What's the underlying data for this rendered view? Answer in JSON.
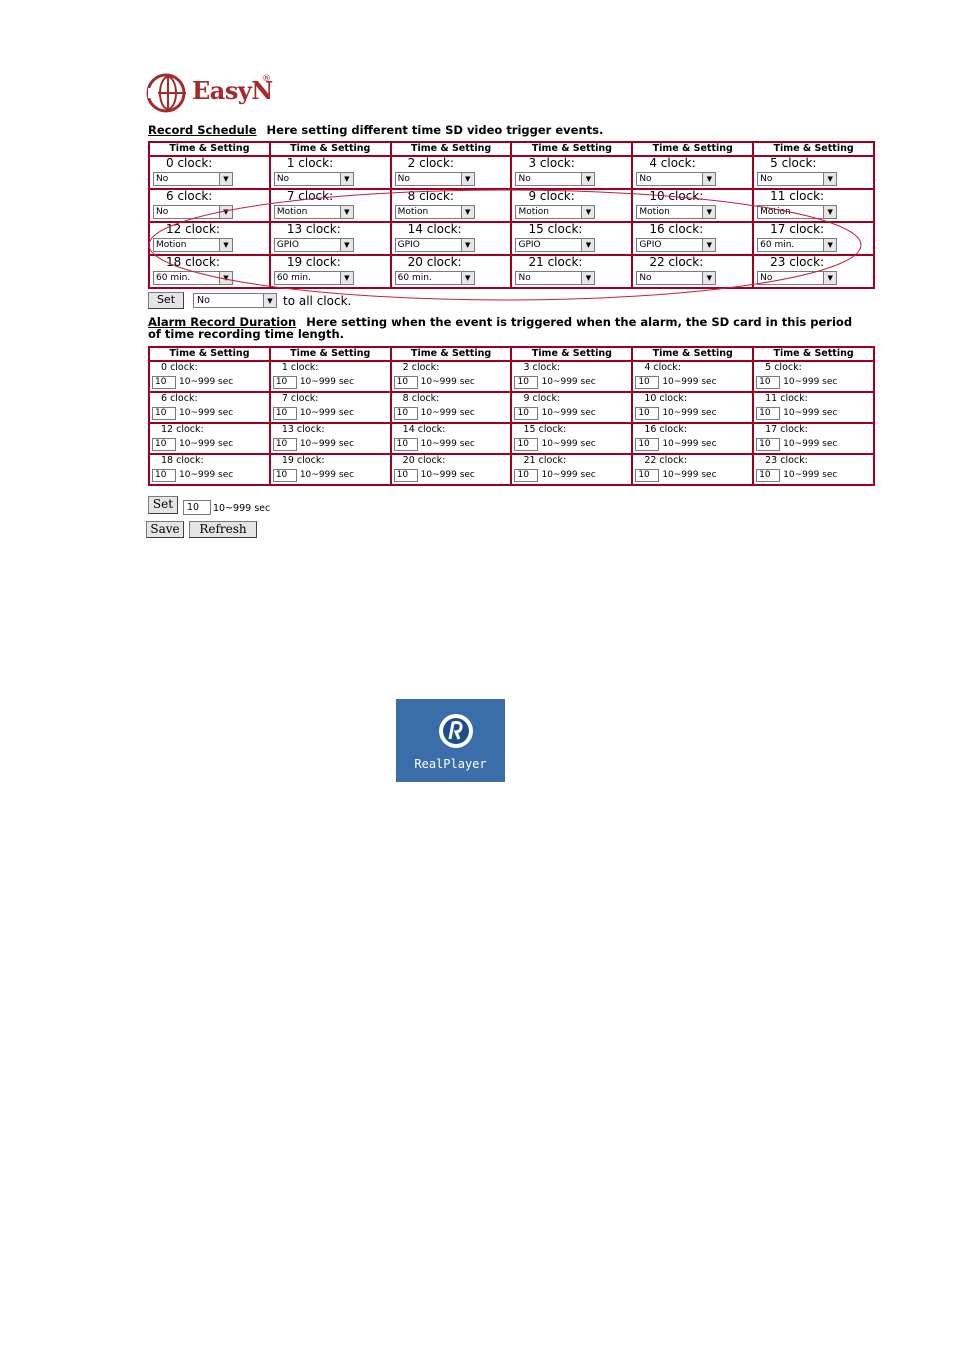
{
  "logo": {
    "text": "EasyN",
    "reg": "®"
  },
  "schedule": {
    "link": "Record Schedule",
    "desc": "Here setting different time SD video trigger events.",
    "header": "Time & Setting",
    "cells": [
      {
        "label": "0 clock:",
        "value": "No"
      },
      {
        "label": "1 clock:",
        "value": "No"
      },
      {
        "label": "2 clock:",
        "value": "No"
      },
      {
        "label": "3 clock:",
        "value": "No"
      },
      {
        "label": "4 clock:",
        "value": "No"
      },
      {
        "label": "5 clock:",
        "value": "No"
      },
      {
        "label": "6 clock:",
        "value": "No"
      },
      {
        "label": "7 clock:",
        "value": "Motion"
      },
      {
        "label": "8 clock:",
        "value": "Motion"
      },
      {
        "label": "9 clock:",
        "value": "Motion"
      },
      {
        "label": "10 clock:",
        "value": "Motion"
      },
      {
        "label": "11 clock:",
        "value": "Motion"
      },
      {
        "label": "12 clock:",
        "value": "Motion"
      },
      {
        "label": "13 clock:",
        "value": "GPIO"
      },
      {
        "label": "14 clock:",
        "value": "GPIO"
      },
      {
        "label": "15 clock:",
        "value": "GPIO"
      },
      {
        "label": "16 clock:",
        "value": "GPIO"
      },
      {
        "label": "17 clock:",
        "value": "60 min."
      },
      {
        "label": "18 clock:",
        "value": "60 min."
      },
      {
        "label": "19 clock:",
        "value": "60 min."
      },
      {
        "label": "20 clock:",
        "value": "60 min."
      },
      {
        "label": "21 clock:",
        "value": "No"
      },
      {
        "label": "22 clock:",
        "value": "No"
      },
      {
        "label": "23 clock:",
        "value": "No"
      }
    ],
    "set_label": "Set",
    "set_value": "No",
    "to_all": "to all clock."
  },
  "duration": {
    "link": "Alarm Record Duration",
    "desc": "Here setting when the event is triggered when the alarm, the SD card in this period of time recording time length.",
    "header": "Time & Setting",
    "range": "10~999 sec",
    "cells": [
      {
        "label": "0 clock:",
        "value": "10"
      },
      {
        "label": "1 clock:",
        "value": "10"
      },
      {
        "label": "2 clock:",
        "value": "10"
      },
      {
        "label": "3 clock:",
        "value": "10"
      },
      {
        "label": "4 clock:",
        "value": "10"
      },
      {
        "label": "5 clock:",
        "value": "10"
      },
      {
        "label": "6 clock:",
        "value": "10"
      },
      {
        "label": "7 clock:",
        "value": "10"
      },
      {
        "label": "8 clock:",
        "value": "10"
      },
      {
        "label": "9 clock:",
        "value": "10"
      },
      {
        "label": "10 clock:",
        "value": "10"
      },
      {
        "label": "11 clock:",
        "value": "10"
      },
      {
        "label": "12 clock:",
        "value": "10"
      },
      {
        "label": "13 clock:",
        "value": "10"
      },
      {
        "label": "14 clock:",
        "value": "10"
      },
      {
        "label": "15 clock:",
        "value": "10"
      },
      {
        "label": "16 clock:",
        "value": "10"
      },
      {
        "label": "17 clock:",
        "value": "10"
      },
      {
        "label": "18 clock:",
        "value": "10"
      },
      {
        "label": "19 clock:",
        "value": "10"
      },
      {
        "label": "20 clock:",
        "value": "10"
      },
      {
        "label": "21 clock:",
        "value": "10"
      },
      {
        "label": "22 clock:",
        "value": "10"
      },
      {
        "label": "23 clock:",
        "value": "10"
      }
    ],
    "set_label": "Set",
    "set_value": "10",
    "set_range": "10~999 sec"
  },
  "actions": {
    "save": "Save",
    "refresh": "Refresh"
  },
  "realplayer": {
    "label": "RealPlayer",
    "icon": "realplayer-icon"
  },
  "colors": {
    "brand": "#a52a2a",
    "grid": "#a00020",
    "annotation": "#c0203a",
    "realplayer_bg": "#3a6ea8"
  }
}
